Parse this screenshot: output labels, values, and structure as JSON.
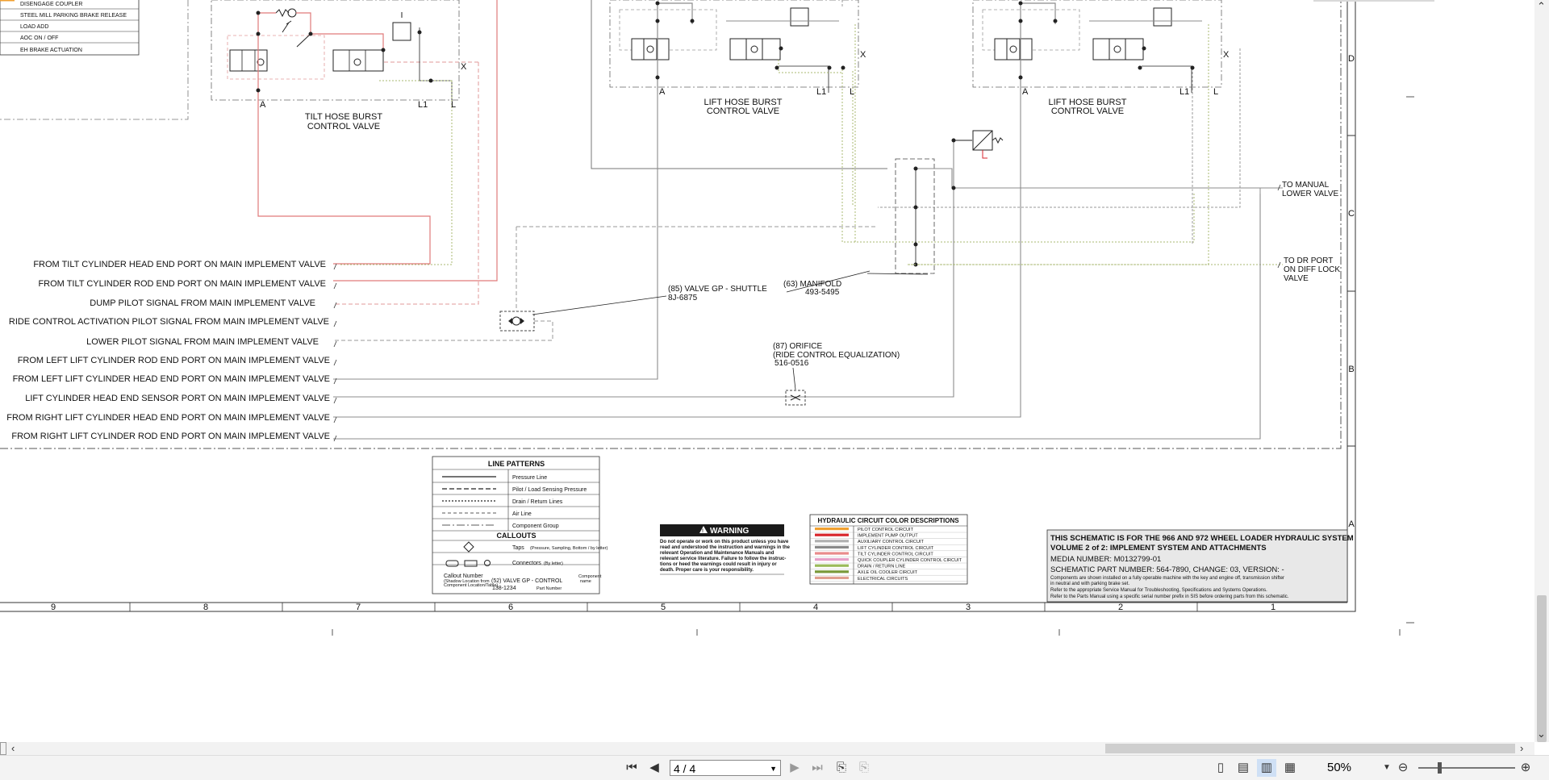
{
  "legend_top_rows": [
    "DISENGAGE COUPLER",
    "STEEL MILL PARKING BRAKE RELEASE",
    "LOAD ADD",
    "AOC ON / OFF",
    "EH BRAKE ACTUATION"
  ],
  "valve_titles": {
    "tilt_line1": "TILT HOSE BURST",
    "tilt_line2": "CONTROL VALVE",
    "lift1_line1": "LIFT HOSE BURST",
    "lift1_line2": "CONTROL VALVE",
    "lift2_line1": "LIFT HOSE BURST",
    "lift2_line2": "CONTROL VALVE"
  },
  "port_labels": {
    "a": "A",
    "l1": "L1",
    "l": "L",
    "x": "X"
  },
  "signal_lines": [
    "FROM TILT CYLINDER HEAD END PORT ON MAIN IMPLEMENT VALVE",
    "FROM TILT CYLINDER ROD END PORT ON MAIN IMPLEMENT VALVE",
    "DUMP PILOT SIGNAL FROM MAIN IMPLEMENT VALVE",
    "RIDE CONTROL ACTIVATION PILOT SIGNAL FROM MAIN IMPLEMENT VALVE",
    "LOWER PILOT SIGNAL FROM MAIN IMPLEMENT VALVE",
    "FROM LEFT LIFT CYLINDER ROD END PORT ON MAIN IMPLEMENT VALVE",
    "FROM LEFT LIFT CYLINDER HEAD END PORT ON MAIN IMPLEMENT VALVE",
    "LIFT CYLINDER HEAD END SENSOR PORT ON MAIN IMPLEMENT VALVE",
    "FROM RIGHT LIFT CYLINDER HEAD END PORT ON MAIN IMPLEMENT VALVE",
    "FROM RIGHT LIFT CYLINDER ROD END PORT ON MAIN IMPLEMENT VALVE"
  ],
  "callouts": {
    "shuttle_1": "(85) VALVE GP - SHUTTLE",
    "shuttle_2": "8J-6875",
    "manifold_1": "(63) MANIFOLD",
    "manifold_2": "493-5495",
    "orifice_1": "(87) ORIFICE",
    "orifice_2": "(RIDE CONTROL EQUALIZATION)",
    "orifice_3": "516-0516",
    "manual_1": "TO MANUAL",
    "manual_2": "LOWER VALVE",
    "dr_1": "TO DR PORT",
    "dr_2": "ON DIFF LOCK",
    "dr_3": "VALVE"
  },
  "zone_letters": [
    "D",
    "C",
    "B",
    "A"
  ],
  "column_numbers": [
    "9",
    "8",
    "7",
    "6",
    "5",
    "4",
    "3",
    "2",
    "1"
  ],
  "line_patterns": {
    "title": "LINE PATTERNS",
    "items": [
      "Pressure Line",
      "Pilot / Load Sensing Pressure",
      "Drain / Return Lines",
      "Air Line",
      "Component Group"
    ],
    "callouts_title": "CALLOUTS",
    "taps": "Taps",
    "taps_note": "(Pressure, Sampling, Bottom / by letter)",
    "connectors": "Connectors",
    "connectors_note": "(By letter)",
    "callout_number": "Callout Number",
    "callout_note1": "(Shadow Location from",
    "callout_note2": "Component Location/Table)",
    "callout_example": "(52) VALVE GP - CONTROL",
    "component_name": "Component",
    "component_name2": "name",
    "part_example": "138-1234",
    "part_number": "Part Number"
  },
  "warning": {
    "title": "WARNING",
    "lines": [
      "Do not operate or work on this product unless you have",
      "read and understood the instruction and warnings in the",
      "relevant Operation and Maintenance Manuals and",
      "relevant service literature. Failure to follow the instruc-",
      "tions or heed the warnings could result in injury or",
      "death. Proper care is your responsibility."
    ]
  },
  "color_desc": {
    "title": "HYDRAULIC CIRCUIT COLOR DESCRIPTIONS",
    "items": [
      {
        "label": "PILOT CONTROL CIRCUIT",
        "color": "#f0a030"
      },
      {
        "label": "IMPLEMENT PUMP OUTPUT",
        "color": "#d9262c"
      },
      {
        "label": "AUXILIARY CONTROL CIRCUIT",
        "color": "#b0b0b0"
      },
      {
        "label": "LIFT CYLINDER CONTROL CIRCUIT",
        "color": "#8a8a8a"
      },
      {
        "label": "TILT CYLINDER CONTROL CIRCUIT",
        "color": "#e98b8b"
      },
      {
        "label": "QUICK COUPLER CYLINDER CONTROL CIRCUIT",
        "color": "#e7a0c8"
      },
      {
        "label": "DRAIN / RETURN LINE",
        "color": "#9bbb59"
      },
      {
        "label": "AXLE OIL COOLER CIRCUIT",
        "color": "#7a9a3a"
      },
      {
        "label": "ELECTRICAL CIRCUITS",
        "color": "#e0a090"
      }
    ]
  },
  "title_block": {
    "line1": "THIS SCHEMATIC IS FOR THE 966 AND 972 WHEEL LOADER HYDRAULIC SYSTEM",
    "line2": "VOLUME 2 of 2: IMPLEMENT SYSTEM AND ATTACHMENTS",
    "line3": "MEDIA NUMBER: M0132799-01",
    "line4": "SCHEMATIC PART NUMBER: 564-7890, CHANGE: 03, VERSION: -",
    "note1": "Components are shown installed on a fully operable machine with the key and engine off, transmission shifter",
    "note2": "in neutral and with parking brake set.",
    "note3": "Refer to the appropriate Service Manual for Troubleshooting, Specifications and Systems Operations.",
    "note4": "Refer to the Parts Manual using a specific serial number prefix in SIS before ordering parts from this schematic."
  },
  "colors": {
    "tilt_line": "#e07a7a",
    "lift_line": "#8c8c8c",
    "drain_line": "#a8b870",
    "pilot_dashed": "#e29a9a",
    "pilot_gray_dashed": "#9a9a9a"
  },
  "toolbar": {
    "page_indicator": "4 / 4",
    "zoom": "50%"
  },
  "icons": {
    "first_page": "first-page-icon",
    "prev_page": "prev-page-icon",
    "next_page": "next-page-icon",
    "last_page": "last-page-icon",
    "zoom_out": "zoom-out-icon",
    "zoom_in": "zoom-in-icon"
  }
}
